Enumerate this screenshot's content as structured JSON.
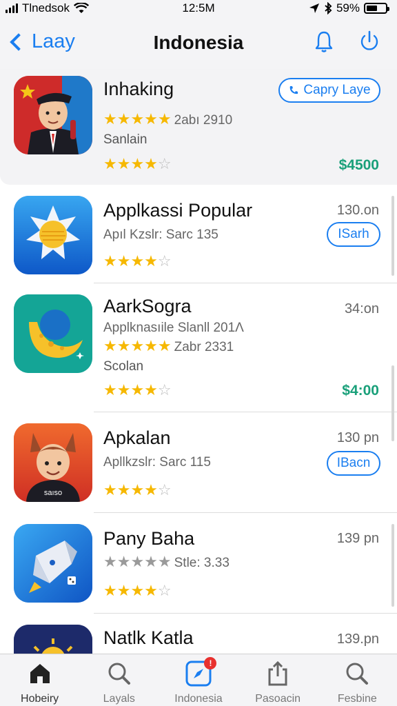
{
  "status_bar": {
    "carrier": "Tlnedsok",
    "time": "12:5M",
    "battery_text": "59%",
    "battery_level": 0.59
  },
  "nav": {
    "back_label": "Laay",
    "title": "Indonesia",
    "bell_icon": "bell-icon",
    "power_icon": "power-icon"
  },
  "apps": [
    {
      "name": "Inhaking",
      "subtitle": "",
      "rating_text": "2abı 2910",
      "rating_stars": 5,
      "extra": "Sanlain",
      "stars_bottom": 4,
      "size": "",
      "price": "$4500",
      "button": "Capry Laye",
      "icon": "person-in-uniform-icon"
    },
    {
      "name": "Applkassi Popular",
      "subtitle": "Apıl Kzslr: Sarc 135",
      "size": "130.on",
      "button": "ISarh",
      "stars_bottom": 4,
      "icon": "sun-icon"
    },
    {
      "name": "AarkSogra",
      "subtitle": "Applknasıile Slanll 201Λ",
      "rating_text": "Zabr 2331",
      "rating_stars": 5,
      "extra": "Scolan",
      "size": "34:on",
      "price": "$4:00",
      "stars_bottom": 4,
      "icon": "crescent-moon-icon"
    },
    {
      "name": "Apkalan",
      "subtitle": "Apllkzslr: Sarc 115",
      "size": "130 pn",
      "button": "IBacn",
      "stars_bottom": 4,
      "icon": "character-avatar-icon",
      "shirt_text": "saıso"
    },
    {
      "name": "Pany Baha",
      "subtitle": "Stle: 3.33",
      "rating_stars_grey": 5,
      "size": "139 pn",
      "stars_bottom": 4,
      "icon": "polygon-rocket-icon"
    },
    {
      "name": "Natlk Katla",
      "size": "139.pn",
      "icon": "sunrise-icon"
    }
  ],
  "tabs": [
    {
      "label": "Hobeiry",
      "icon": "home-icon",
      "active": true
    },
    {
      "label": "Layals",
      "icon": "search-icon"
    },
    {
      "label": "Indonesia",
      "icon": "compass-icon",
      "badge": "!"
    },
    {
      "label": "Pasoacin",
      "icon": "share-icon"
    },
    {
      "label": "Fesbine",
      "icon": "search-icon"
    }
  ],
  "colors": {
    "accent": "#1a7ef0",
    "star": "#f6b800",
    "price": "#1aa07a",
    "badge": "#e8302e"
  }
}
